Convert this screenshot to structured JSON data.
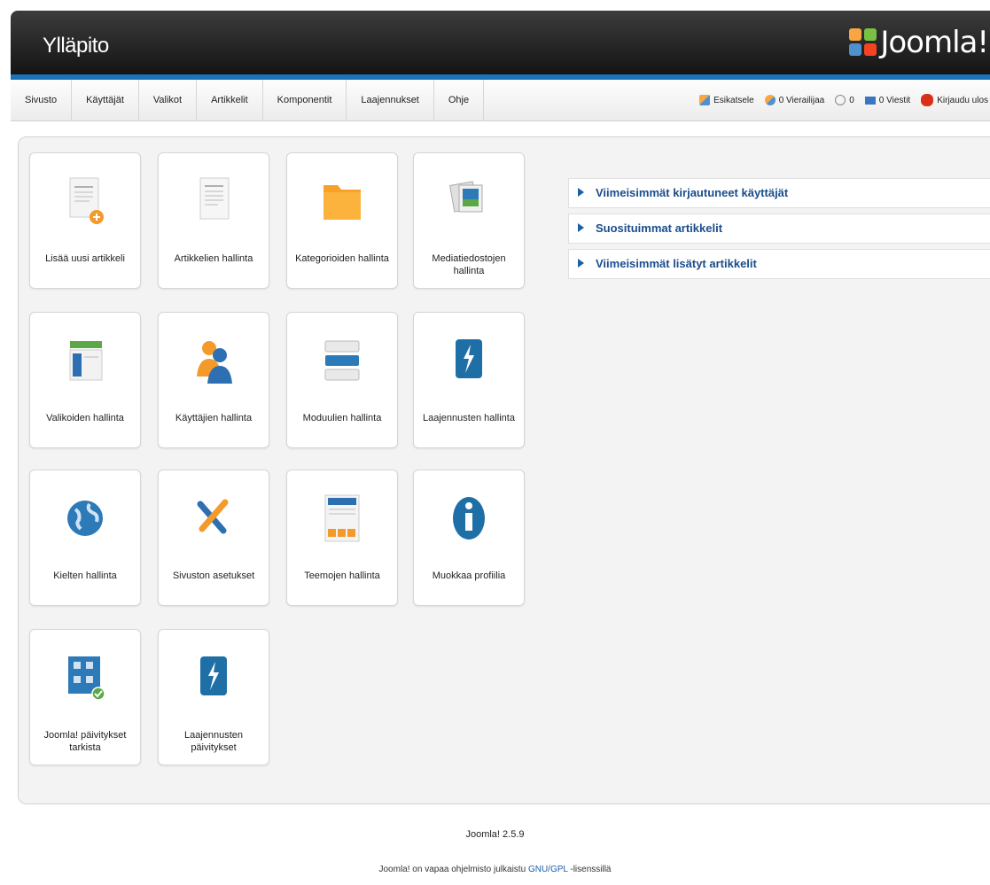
{
  "header": {
    "title": "Ylläpito",
    "logo_text": "Joomla!"
  },
  "menu": {
    "items": [
      {
        "id": "site",
        "label": "Sivusto"
      },
      {
        "id": "users",
        "label": "Käyttäjät"
      },
      {
        "id": "menus",
        "label": "Valikot"
      },
      {
        "id": "content",
        "label": "Artikkelit"
      },
      {
        "id": "components",
        "label": "Komponentit"
      },
      {
        "id": "extensions",
        "label": "Laajennukset"
      },
      {
        "id": "help",
        "label": "Ohje"
      }
    ]
  },
  "status": {
    "items": [
      {
        "id": "preview",
        "label": "Esikatsele",
        "icon": "preview-icon"
      },
      {
        "id": "visitors",
        "label": "0 Vierailijaa",
        "icon": "visitors-icon"
      },
      {
        "id": "admins",
        "label": "0",
        "icon": "admins-icon"
      },
      {
        "id": "messages",
        "label": "0 Viestit",
        "icon": "messages-icon"
      },
      {
        "id": "logout",
        "label": "Kirjaudu ulos",
        "icon": "logout-icon"
      }
    ]
  },
  "tiles": [
    {
      "id": "add-article",
      "label": "Lisää uusi artikkeli",
      "icon": "add-article-icon"
    },
    {
      "id": "article-manager",
      "label": "Artikkelien hallinta",
      "icon": "article-icon"
    },
    {
      "id": "category-manager",
      "label": "Kategorioiden hallinta",
      "icon": "folder-icon"
    },
    {
      "id": "media-manager",
      "label": "Mediatiedostojen hallinta",
      "icon": "media-icon"
    },
    {
      "id": "menu-manager",
      "label": "Valikoiden hallinta",
      "icon": "menu-icon"
    },
    {
      "id": "user-manager",
      "label": "Käyttäjien hallinta",
      "icon": "users-icon"
    },
    {
      "id": "module-manager",
      "label": "Moduulien hallinta",
      "icon": "modules-icon"
    },
    {
      "id": "extension-manager",
      "label": "Laajennusten hallinta",
      "icon": "extensions-icon"
    },
    {
      "id": "language-manager",
      "label": "Kielten hallinta",
      "icon": "language-icon"
    },
    {
      "id": "global-config",
      "label": "Sivuston asetukset",
      "icon": "config-icon"
    },
    {
      "id": "template-manager",
      "label": "Teemojen hallinta",
      "icon": "template-icon"
    },
    {
      "id": "profile",
      "label": "Muokkaa profiilia",
      "icon": "info-icon"
    },
    {
      "id": "update",
      "label": "Joomla! päivitykset tarkista",
      "icon": "joomla-update-icon"
    },
    {
      "id": "extension-update",
      "label": "Laajennusten päivitykset",
      "icon": "extension-update-icon"
    }
  ],
  "panels": [
    {
      "id": "logged-in",
      "label": "Viimeisimmät kirjautuneet käyttäjät"
    },
    {
      "id": "popular",
      "label": "Suosituimmat artikkelit"
    },
    {
      "id": "recent",
      "label": "Viimeisimmät lisätyt artikkelit"
    }
  ],
  "footer": {
    "version": "Joomla! 2.5.9",
    "license_prefix": "Joomla! on vapaa ohjelmisto julkaistu",
    "license_link": "GNU/GPL",
    "license_suffix": "-lisenssillä"
  },
  "colors": {
    "accent": "#1a72b9",
    "header_bg": "#1f1f1f",
    "link": "#1a4d8c"
  }
}
